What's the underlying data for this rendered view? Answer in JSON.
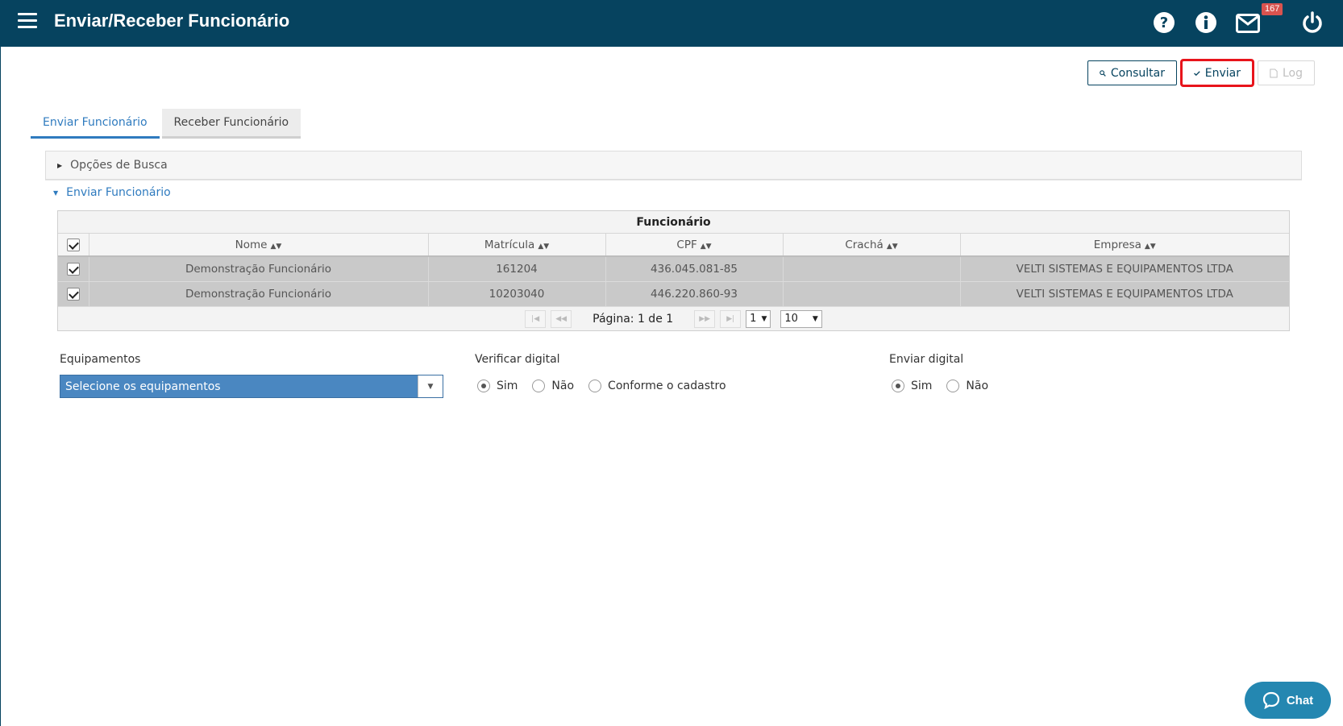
{
  "header": {
    "title": "Enviar/Receber Funcionário",
    "mail_count": "167",
    "icons": [
      "menu-icon",
      "help-icon",
      "info-icon",
      "mail-icon",
      "power-icon"
    ],
    "bg_color": "#06435f"
  },
  "toolbar": {
    "consultar_label": "Consultar",
    "enviar_label": "Enviar",
    "log_label": "Log"
  },
  "tabs": [
    {
      "label": "Enviar Funcionário",
      "active": true
    },
    {
      "label": "Receber Funcionário",
      "active": false
    }
  ],
  "search_options": {
    "label": "Opções de Busca"
  },
  "section": {
    "label": "Enviar Funcionário"
  },
  "grid": {
    "caption": "Funcionário",
    "columns": [
      "Nome",
      "Matrícula",
      "CPF",
      "Crachá",
      "Empresa"
    ],
    "rows": [
      {
        "checked": true,
        "nome": "Demonstração Funcionário",
        "matricula": "161204",
        "cpf": "436.045.081-85",
        "cracha": "",
        "empresa": "VELTI SISTEMAS E EQUIPAMENTOS LTDA"
      },
      {
        "checked": true,
        "nome": "Demonstração Funcionário",
        "matricula": "10203040",
        "cpf": "446.220.860-93",
        "cracha": "",
        "empresa": "VELTI SISTEMAS E EQUIPAMENTOS LTDA"
      }
    ],
    "pager": {
      "info": "Página: 1 de 1",
      "page": "1",
      "page_size": "10"
    }
  },
  "form": {
    "equipamentos": {
      "label": "Equipamentos",
      "value": "Selecione os equipamentos"
    },
    "verificar_digital": {
      "label": "Verificar digital",
      "options": [
        "Sim",
        "Não",
        "Conforme o cadastro"
      ],
      "selected": "Sim"
    },
    "enviar_digital": {
      "label": "Enviar digital",
      "options": [
        "Sim",
        "Não"
      ],
      "selected": "Sim"
    }
  },
  "chat": {
    "label": "Chat"
  }
}
